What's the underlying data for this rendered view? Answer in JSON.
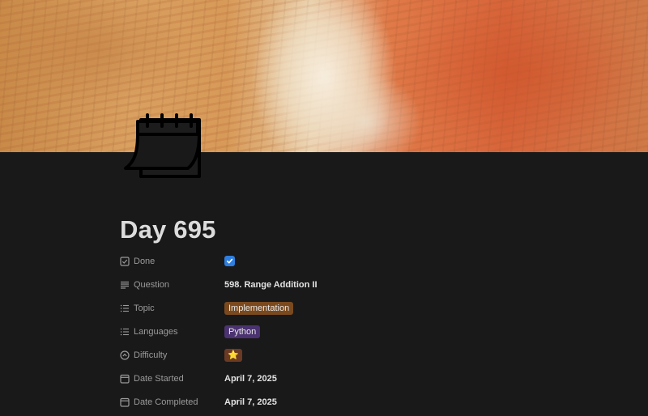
{
  "page": {
    "title": "Day 695",
    "icon": "calendar-icon"
  },
  "properties": [
    {
      "label": "Done",
      "icon": "checkbox-icon",
      "type": "checkbox",
      "checked": true
    },
    {
      "label": "Question",
      "icon": "text-lines-icon",
      "type": "text",
      "value": "598. Range Addition II"
    },
    {
      "label": "Topic",
      "icon": "list-icon",
      "type": "tag",
      "value": "Implementation",
      "color": "#7a4a1e"
    },
    {
      "label": "Languages",
      "icon": "list-icon",
      "type": "tag",
      "value": "Python",
      "color": "#4b3270"
    },
    {
      "label": "Difficulty",
      "icon": "circle-chevron-icon",
      "type": "tag",
      "value": "⭐",
      "color": "#6b3a25"
    },
    {
      "label": "Date Started",
      "icon": "calendar-small-icon",
      "type": "date",
      "value": "April 7, 2025"
    },
    {
      "label": "Date Completed",
      "icon": "calendar-small-icon",
      "type": "date",
      "value": "April 7, 2025"
    }
  ],
  "colors": {
    "background": "#191919",
    "checkbox": "#2f7fe0"
  }
}
